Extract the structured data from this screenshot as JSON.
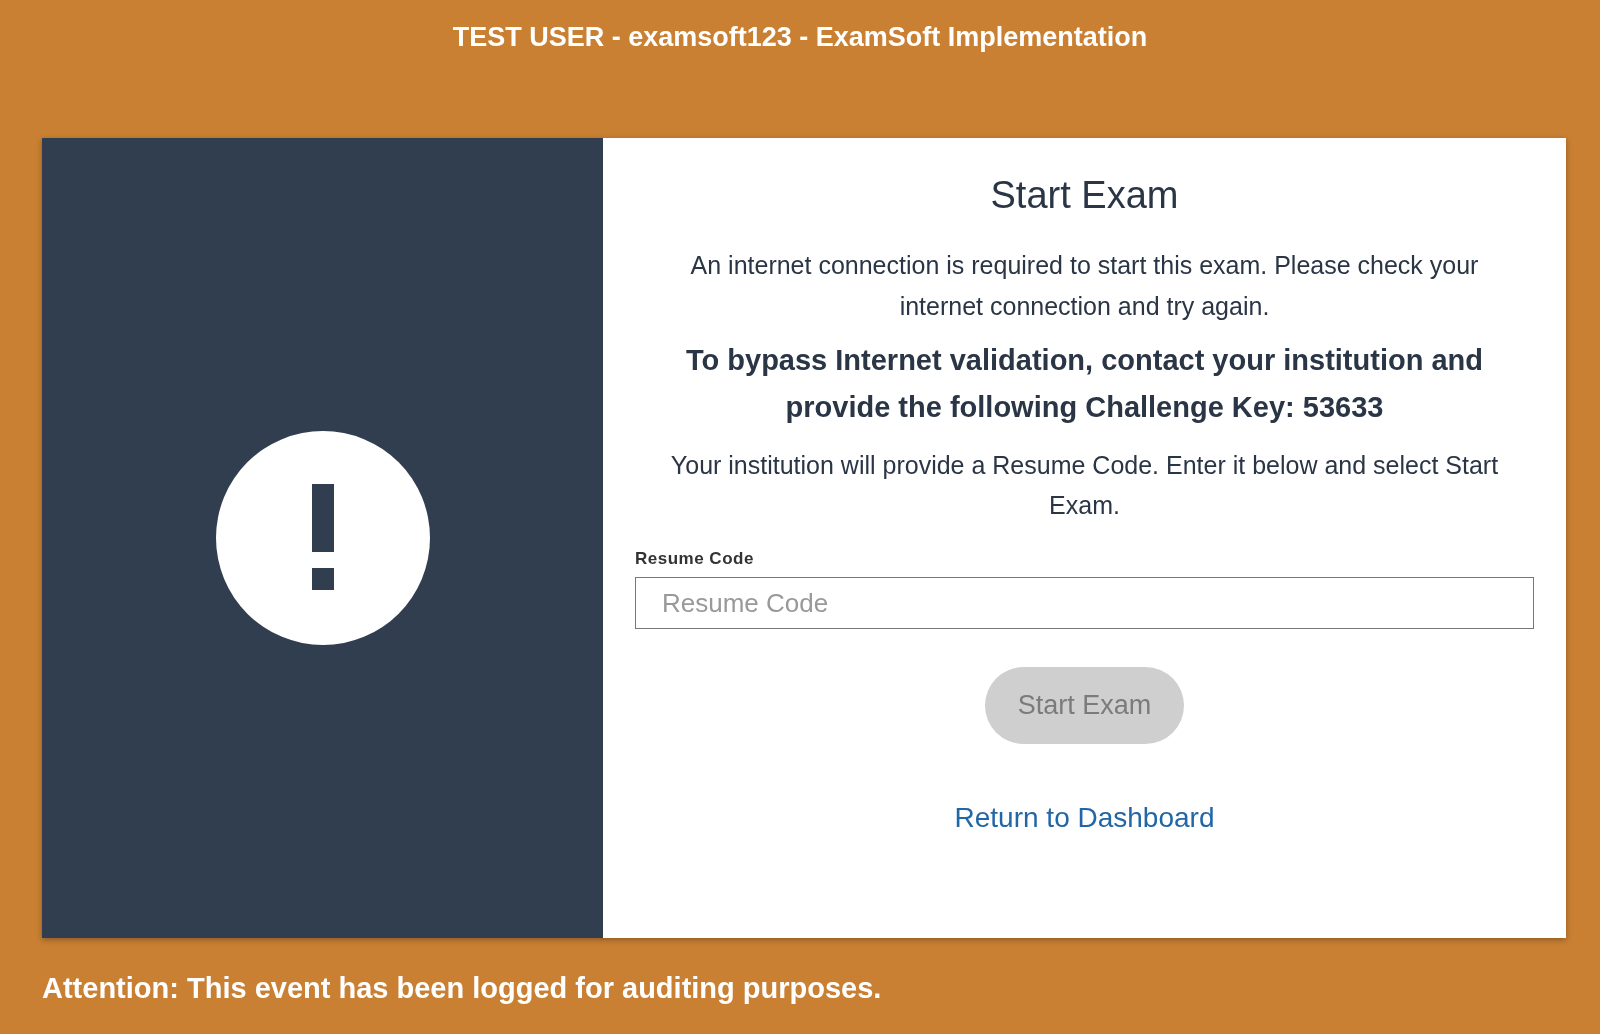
{
  "header": {
    "title": "TEST USER - examsoft123 - ExamSoft Implementation"
  },
  "dialog": {
    "title": "Start Exam",
    "message": "An internet connection is required to start this exam. Please check your internet connection and try again.",
    "bypass": "To bypass Internet validation, contact your institution and provide the following Challenge Key: 53633",
    "instructions": "Your institution will provide a Resume Code. Enter it below and select Start Exam.",
    "field": {
      "label": "Resume Code",
      "placeholder": "Resume Code"
    },
    "button": {
      "label": "Start Exam",
      "disabled": true
    },
    "link": "Return to Dashboard"
  },
  "footer": "Attention: This event has been logged for auditing purposes."
}
